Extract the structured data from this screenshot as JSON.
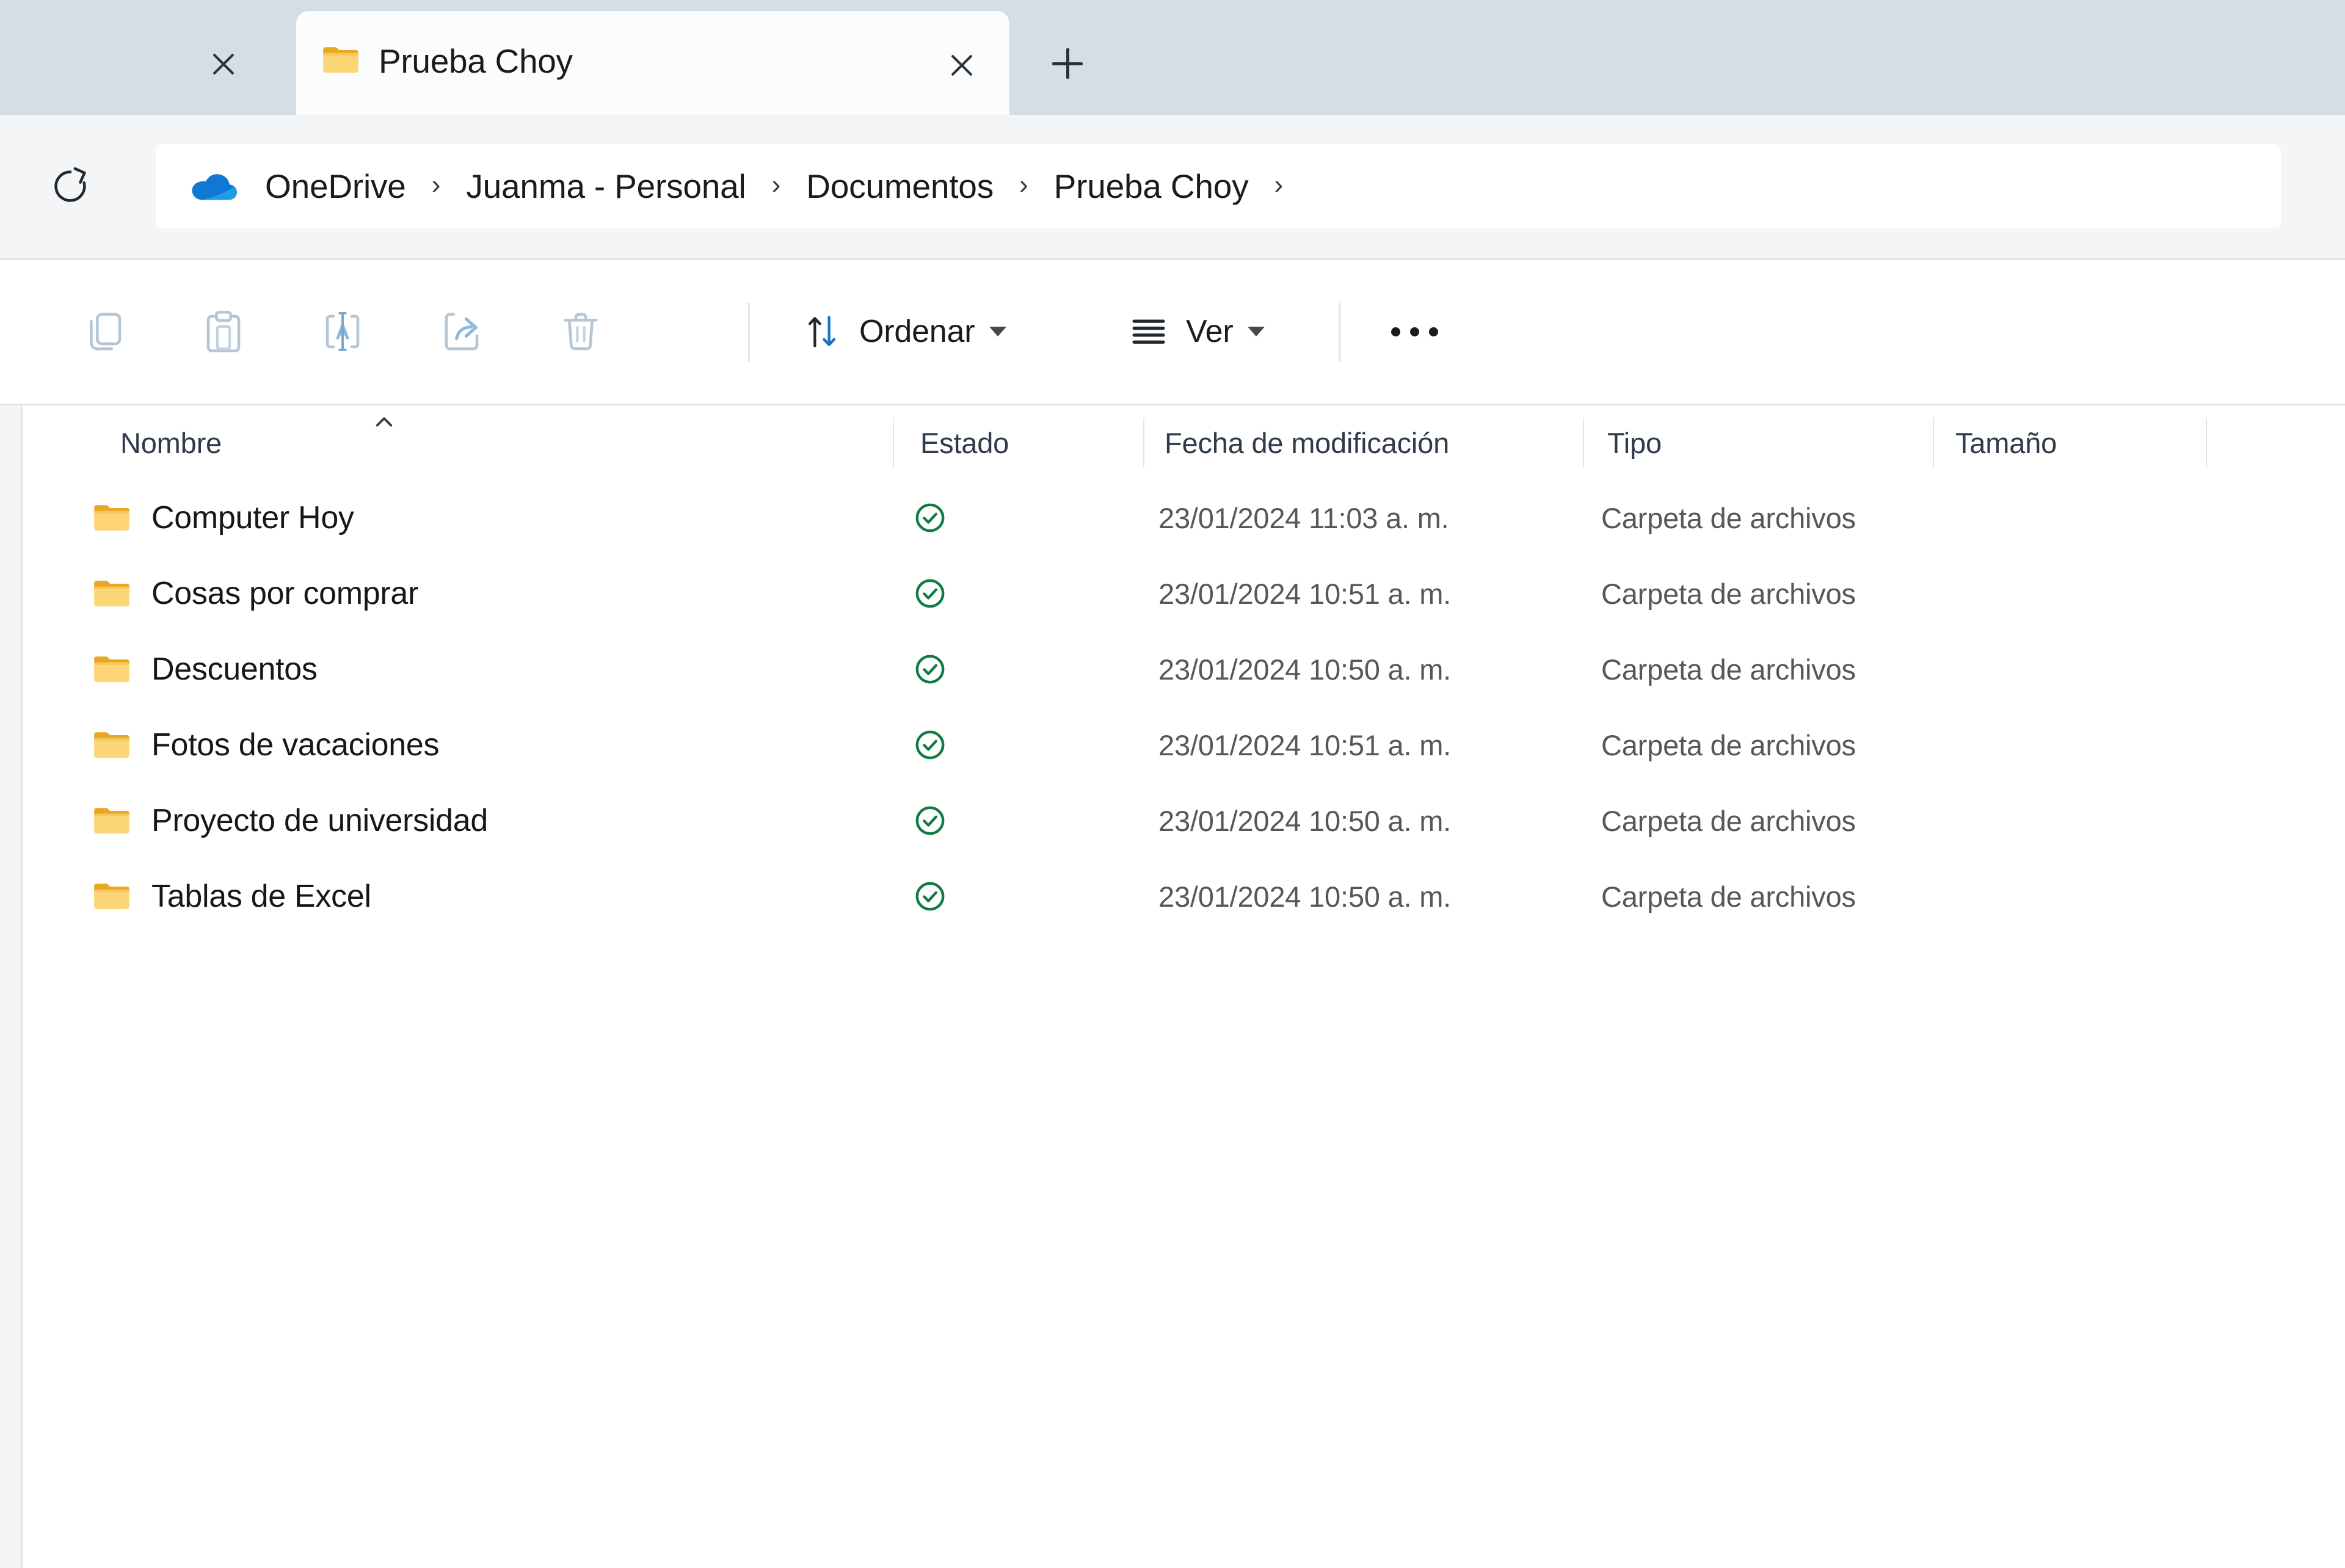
{
  "window": {
    "tabbar": {
      "left_close_icon": "close-icon",
      "active_tab": {
        "icon": "folder-icon",
        "title": "Prueba Choy",
        "close_icon": "close-icon"
      },
      "new_tab_icon": "plus-icon",
      "background_color": "#d5dee4"
    },
    "address": {
      "refresh_icon": "refresh-icon",
      "drive_icon": "onedrive-cloud-icon",
      "drive_icon_color": "#0f78d4",
      "separator": "›",
      "breadcrumbs": [
        "OneDrive",
        "Juanma - Personal",
        "Documentos",
        "Prueba Choy"
      ]
    },
    "toolbar": {
      "icon_buttons": [
        {
          "name": "copy-icon",
          "label": "Copiar"
        },
        {
          "name": "paste-icon",
          "label": "Pegar"
        },
        {
          "name": "rename-icon",
          "label": "Cambiar nombre"
        },
        {
          "name": "share-icon",
          "label": "Compartir"
        },
        {
          "name": "delete-icon",
          "label": "Eliminar"
        }
      ],
      "sort": {
        "icon": "sort-arrows-icon",
        "label": "Ordenar",
        "chevron": "chevron-down-icon"
      },
      "view": {
        "icon": "view-list-icon",
        "label": "Ver",
        "chevron": "chevron-down-icon"
      },
      "more": {
        "icon": "ellipsis-icon",
        "label": "Ver más"
      },
      "icon_color": "#b6c6d4"
    },
    "filelist": {
      "sort_indicator": "sort-ascending-chevron-icon",
      "columns": [
        {
          "key": "name",
          "label": "Nombre"
        },
        {
          "key": "status",
          "label": "Estado"
        },
        {
          "key": "date",
          "label": "Fecha de modificación"
        },
        {
          "key": "type",
          "label": "Tipo"
        },
        {
          "key": "size",
          "label": "Tamaño"
        }
      ],
      "status_icon": "sync-complete-check-icon",
      "status_icon_color": "#107c41",
      "folder_icon_color": "#f7cb5d",
      "rows": [
        {
          "icon": "folder-icon",
          "name": "Computer Hoy",
          "status": "sync-complete-check-icon",
          "date": "23/01/2024 11:03 a. m.",
          "type": "Carpeta de archivos",
          "size": ""
        },
        {
          "icon": "folder-icon",
          "name": "Cosas por comprar",
          "status": "sync-complete-check-icon",
          "date": "23/01/2024 10:51 a. m.",
          "type": "Carpeta de archivos",
          "size": ""
        },
        {
          "icon": "folder-icon",
          "name": "Descuentos",
          "status": "sync-complete-check-icon",
          "date": "23/01/2024 10:50 a. m.",
          "type": "Carpeta de archivos",
          "size": ""
        },
        {
          "icon": "folder-icon",
          "name": "Fotos de vacaciones",
          "status": "sync-complete-check-icon",
          "date": "23/01/2024 10:51 a. m.",
          "type": "Carpeta de archivos",
          "size": ""
        },
        {
          "icon": "folder-icon",
          "name": "Proyecto de universidad",
          "status": "sync-complete-check-icon",
          "date": "23/01/2024 10:50 a. m.",
          "type": "Carpeta de archivos",
          "size": ""
        },
        {
          "icon": "folder-icon",
          "name": "Tablas de Excel",
          "status": "sync-complete-check-icon",
          "date": "23/01/2024 10:50 a. m.",
          "type": "Carpeta de archivos",
          "size": ""
        }
      ]
    }
  }
}
